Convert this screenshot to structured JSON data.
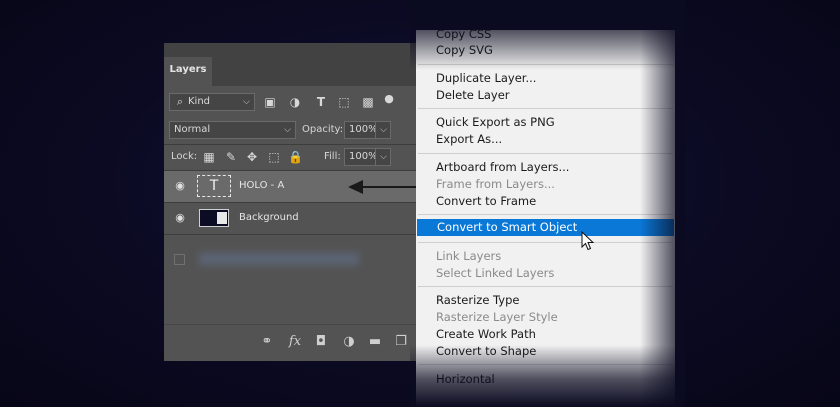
{
  "panel": {
    "tab": "Layers",
    "filter": {
      "label": "Kind"
    },
    "blend": {
      "mode": "Normal",
      "opacity_label": "Opacity:",
      "opacity": "100%"
    },
    "lock": {
      "label": "Lock:",
      "fill_label": "Fill:",
      "fill": "100%"
    },
    "layers": [
      {
        "name": "HOLO - A",
        "type": "text",
        "visible": true,
        "selected": true
      },
      {
        "name": "Background",
        "type": "image",
        "visible": true,
        "selected": false
      }
    ]
  },
  "menu": {
    "items": [
      {
        "label": "Copy CSS",
        "disabled": false
      },
      {
        "label": "Copy SVG",
        "disabled": false
      },
      {
        "label": "Duplicate Layer...",
        "disabled": false
      },
      {
        "label": "Delete Layer",
        "disabled": false
      },
      {
        "label": "Quick Export as PNG",
        "disabled": false
      },
      {
        "label": "Export As...",
        "disabled": false
      },
      {
        "label": "Artboard from Layers...",
        "disabled": false
      },
      {
        "label": "Frame from Layers...",
        "disabled": true
      },
      {
        "label": "Convert to Frame",
        "disabled": false
      },
      {
        "label": "Convert to Smart Object",
        "disabled": false,
        "highlighted": true
      },
      {
        "label": "Link Layers",
        "disabled": true
      },
      {
        "label": "Select Linked Layers",
        "disabled": true
      },
      {
        "label": "Rasterize Type",
        "disabled": false
      },
      {
        "label": "Rasterize Layer Style",
        "disabled": true
      },
      {
        "label": "Create Work Path",
        "disabled": false
      },
      {
        "label": "Convert to Shape",
        "disabled": false
      },
      {
        "label": "Horizontal",
        "disabled": false
      }
    ]
  },
  "colors": {
    "highlight": "#0a78d7",
    "panel_bg": "#535353",
    "menu_bg": "#f1f1f1"
  }
}
